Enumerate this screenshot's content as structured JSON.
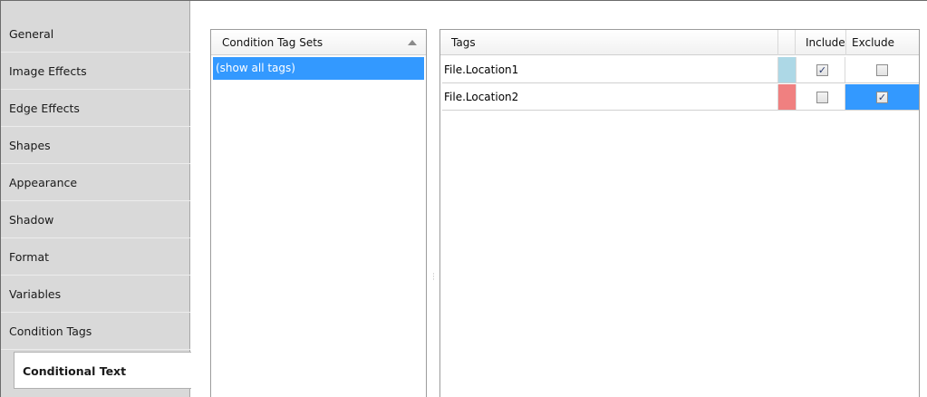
{
  "sidebar": {
    "items": [
      {
        "label": "General"
      },
      {
        "label": "Image Effects"
      },
      {
        "label": "Edge Effects"
      },
      {
        "label": "Shapes"
      },
      {
        "label": "Appearance"
      },
      {
        "label": "Shadow"
      },
      {
        "label": "Format"
      },
      {
        "label": "Variables"
      },
      {
        "label": "Condition Tags"
      },
      {
        "label": "Conditional Text",
        "active": true
      }
    ]
  },
  "tag_sets": {
    "header": "Condition Tag Sets",
    "sort_icon": "sort-ascending-icon",
    "items": [
      {
        "label": "(show all tags)",
        "selected": true
      }
    ]
  },
  "tags_table": {
    "columns": {
      "tags": "Tags",
      "include": "Include",
      "exclude": "Exclude"
    },
    "rows": [
      {
        "name": "File.Location1",
        "color": "#add8e6",
        "include": true,
        "exclude": false,
        "exclude_selected": false
      },
      {
        "name": "File.Location2",
        "color": "#f08080",
        "include": false,
        "exclude": true,
        "exclude_selected": true
      }
    ]
  },
  "colors": {
    "selection": "#3399ff",
    "sidebar_bg": "#d9d9d9"
  }
}
